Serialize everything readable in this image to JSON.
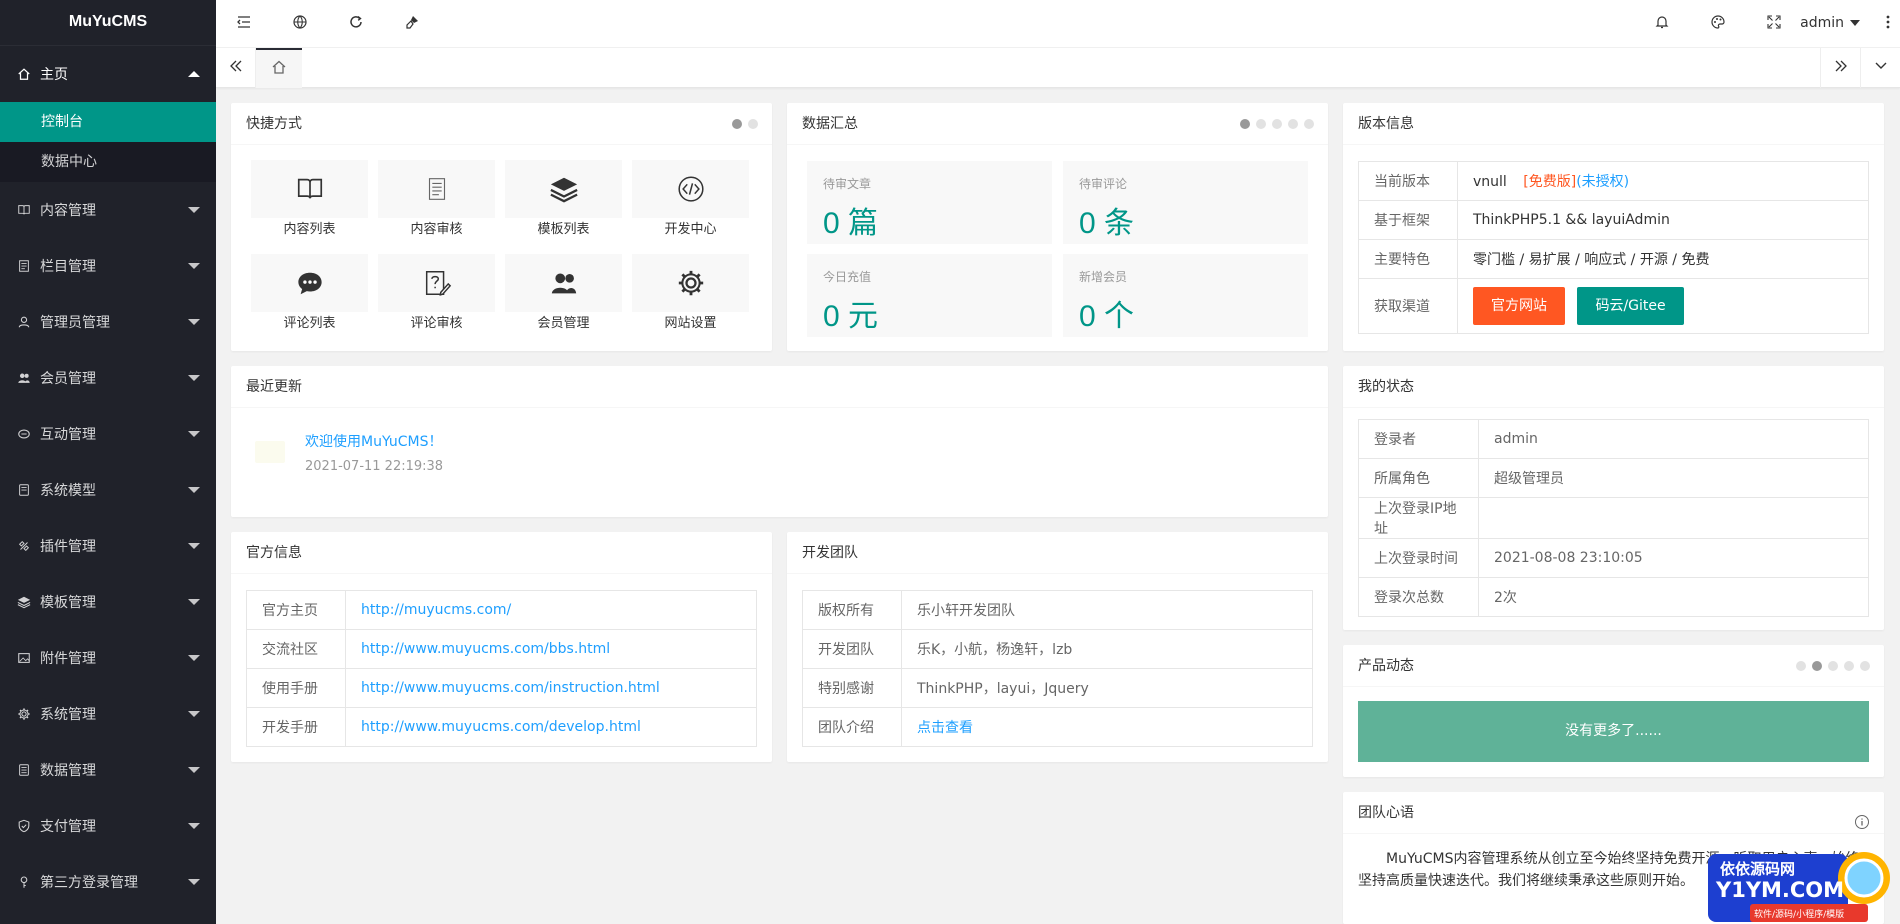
{
  "app": {
    "logo": "MuYuCMS"
  },
  "sidebar": {
    "home": {
      "label": "主页",
      "children": [
        {
          "label": "控制台"
        },
        {
          "label": "数据中心"
        }
      ]
    },
    "items": [
      {
        "label": "内容管理",
        "icon": "book-icon"
      },
      {
        "label": "栏目管理",
        "icon": "list-icon"
      },
      {
        "label": "管理员管理",
        "icon": "user-icon"
      },
      {
        "label": "会员管理",
        "icon": "users-icon"
      },
      {
        "label": "互动管理",
        "icon": "chat-icon"
      },
      {
        "label": "系统模型",
        "icon": "template-icon"
      },
      {
        "label": "插件管理",
        "icon": "plugin-icon"
      },
      {
        "label": "模板管理",
        "icon": "layers-icon"
      },
      {
        "label": "附件管理",
        "icon": "image-icon"
      },
      {
        "label": "系统管理",
        "icon": "gear-icon"
      },
      {
        "label": "数据管理",
        "icon": "database-icon"
      },
      {
        "label": "支付管理",
        "icon": "shield-icon"
      },
      {
        "label": "第三方登录管理",
        "icon": "key-icon"
      }
    ]
  },
  "header": {
    "user": "admin"
  },
  "shortcuts": {
    "title": "快捷方式",
    "items": [
      {
        "label": "内容列表",
        "icon": "book-open-icon"
      },
      {
        "label": "内容审核",
        "icon": "document-icon"
      },
      {
        "label": "模板列表",
        "icon": "layers-icon"
      },
      {
        "label": "开发中心",
        "icon": "code-icon"
      },
      {
        "label": "评论列表",
        "icon": "comment-icon"
      },
      {
        "label": "评论审核",
        "icon": "question-edit-icon"
      },
      {
        "label": "会员管理",
        "icon": "users-icon"
      },
      {
        "label": "网站设置",
        "icon": "gear-icon"
      }
    ]
  },
  "stats": {
    "title": "数据汇总",
    "items": [
      {
        "label": "待审文章",
        "value": "0 篇"
      },
      {
        "label": "待审评论",
        "value": "0 条"
      },
      {
        "label": "今日充值",
        "value": "0 元"
      },
      {
        "label": "新增会员",
        "value": "0 个"
      }
    ]
  },
  "version": {
    "title": "版本信息",
    "rows": [
      {
        "k": "当前版本",
        "v": "vnull",
        "free": "[免费版]",
        "auth": "(未授权)"
      },
      {
        "k": "基于框架",
        "v": "ThinkPHP5.1 && layuiAdmin"
      },
      {
        "k": "主要特色",
        "v": "零门槛 / 易扩展 / 响应式 / 开源 / 免费"
      },
      {
        "k": "获取渠道",
        "btn1": "官方网站",
        "btn2": "码云/Gitee"
      }
    ]
  },
  "recent": {
    "title": "最近更新",
    "items": [
      {
        "title": "欢迎使用MuYuCMS！",
        "date": "2021-07-11 22:19:38"
      }
    ]
  },
  "status": {
    "title": "我的状态",
    "rows": [
      {
        "k": "登录者",
        "v": "admin"
      },
      {
        "k": "所属角色",
        "v": "超级管理员"
      },
      {
        "k": "上次登录IP地址",
        "v": ""
      },
      {
        "k": "上次登录时间",
        "v": "2021-08-08 23:10:05"
      },
      {
        "k": "登录次总数",
        "v": "2次"
      }
    ]
  },
  "official": {
    "title": "官方信息",
    "rows": [
      {
        "k": "官方主页",
        "v": "http://muyucms.com/"
      },
      {
        "k": "交流社区",
        "v": "http://www.muyucms.com/bbs.html"
      },
      {
        "k": "使用手册",
        "v": "http://www.muyucms.com/instruction.html"
      },
      {
        "k": "开发手册",
        "v": "http://www.muyucms.com/develop.html"
      }
    ]
  },
  "team": {
    "title": "开发团队",
    "rows": [
      {
        "k": "版权所有",
        "v": "乐小轩开发团队"
      },
      {
        "k": "开发团队",
        "v": "乐K，小航，杨逸轩，lzb"
      },
      {
        "k": "特别感谢",
        "v": "ThinkPHP，layui，Jquery"
      },
      {
        "k": "团队介绍",
        "v": "点击查看"
      }
    ]
  },
  "product": {
    "title": "产品动态",
    "empty": "没有更多了......"
  },
  "motto": {
    "title": "团队心语",
    "text": "MuYuCMS内容管理系统从创立至今始终坚持免费开源，听取用户心声，始终坚持高质量快速迭代。我们将继续秉承这些原则开始。"
  },
  "watermark": {
    "line1": "依依源码网",
    "line2": "Y1YM.COM",
    "line3": "软件/源码/小程序/模版"
  },
  "colors": {
    "accent": "#009688",
    "sidebar": "#20222a",
    "link": "#1e9fff",
    "orange": "#ff5722"
  }
}
